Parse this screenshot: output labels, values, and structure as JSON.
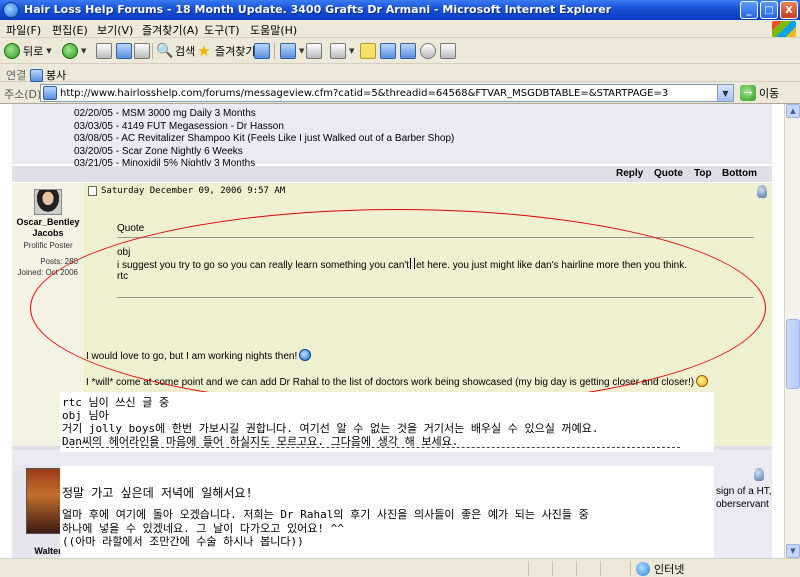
{
  "window": {
    "title": "Hair Loss Help Forums - 18 Month Update. 3400 Grafts Dr Armani - Microsoft Internet Explorer",
    "buttons": [
      "_",
      "□",
      "X"
    ]
  },
  "menu": [
    "파일(F)",
    "편집(E)",
    "보기(V)",
    "즐겨찾기(A)",
    "도구(T)",
    "도움말(H)"
  ],
  "toolbar": {
    "back": "뒤로",
    "search": "검색",
    "favorites": "즐겨찾기"
  },
  "links": {
    "label": "연결",
    "item": "봉사"
  },
  "address": {
    "label": "주소(D)",
    "url": "http://www.hairlosshelp.com/forums/messageview.cfm?catid=5&threadid=64568&FTVAR_MSGDBTABLE=&STARTPAGE=3",
    "go": "이동"
  },
  "prev_signature": [
    "02/20/05 - MSM 3000 mg Daily 3 Months",
    "03/03/05 - 4149 FUT Megasession - Dr Hasson",
    "03/08/05 - AC Revitalizer Shampoo Kit (Feels Like I just Walked out of a Barber Shop)",
    "03/20/05 - Scar Zone Nightly 6 Weeks",
    "03/21/05 - Minoxidil 5% Nightly 3 Months"
  ],
  "actions": [
    "Reply",
    "Quote",
    "Top",
    "Bottom"
  ],
  "post": {
    "username": "Oscar_Bentley Jacobs",
    "rank": "Prolific Poster",
    "posts": "Posts: 280",
    "joined": "Joined: Oct 2006",
    "date": "Saturday December 09, 2006 9:57 AM",
    "quote_label": "Quote",
    "quote_author": "obj",
    "quote_line1_a": "i suggest you try to go so you can really learn something you can't",
    "quote_line1_b": "et here.  you just might like dan's hairline more then you think.",
    "quote_signoff": "rtc",
    "reply1": "I would love to go, but I am working nights then!",
    "reply2": "I *will* come at some point and we can add Dr Rahal to the list of doctors work being showcased (my big day is getting closer and closer!)"
  },
  "translation1": [
    "rtc 님이 쓰신 글 중",
    "obj 님아",
    "거기 jolly boys에 한번 가보시길 권합니다. 여기선 알 수 없는 것을 거기서는 배우실 수 있으실 꺼예요.",
    "Dan씨의 헤어라인을 마음에 들어 하실지도 모르고요. 그다음에 생각 해 보세요."
  ],
  "next_user": "Walter",
  "translation2": [
    "정말 가고 싶은데 저녁에 일해서요!",
    "얼마 후에 여기에 돌아 오겠습니다. 저희는 Dr Rahal의 후기 사진을 의사들이 좋은 예가 되는 사진들 중",
    "하나에 넣을 수 있겠네요. 그 날이 다가오고 있어요! ^^",
    "((아마 라할에서 조만간에 수술 하시나 봅니다))"
  ],
  "sig_fragment": [
    "sign of a HT,",
    "oberservant"
  ],
  "status": {
    "zone": "인터넷"
  }
}
